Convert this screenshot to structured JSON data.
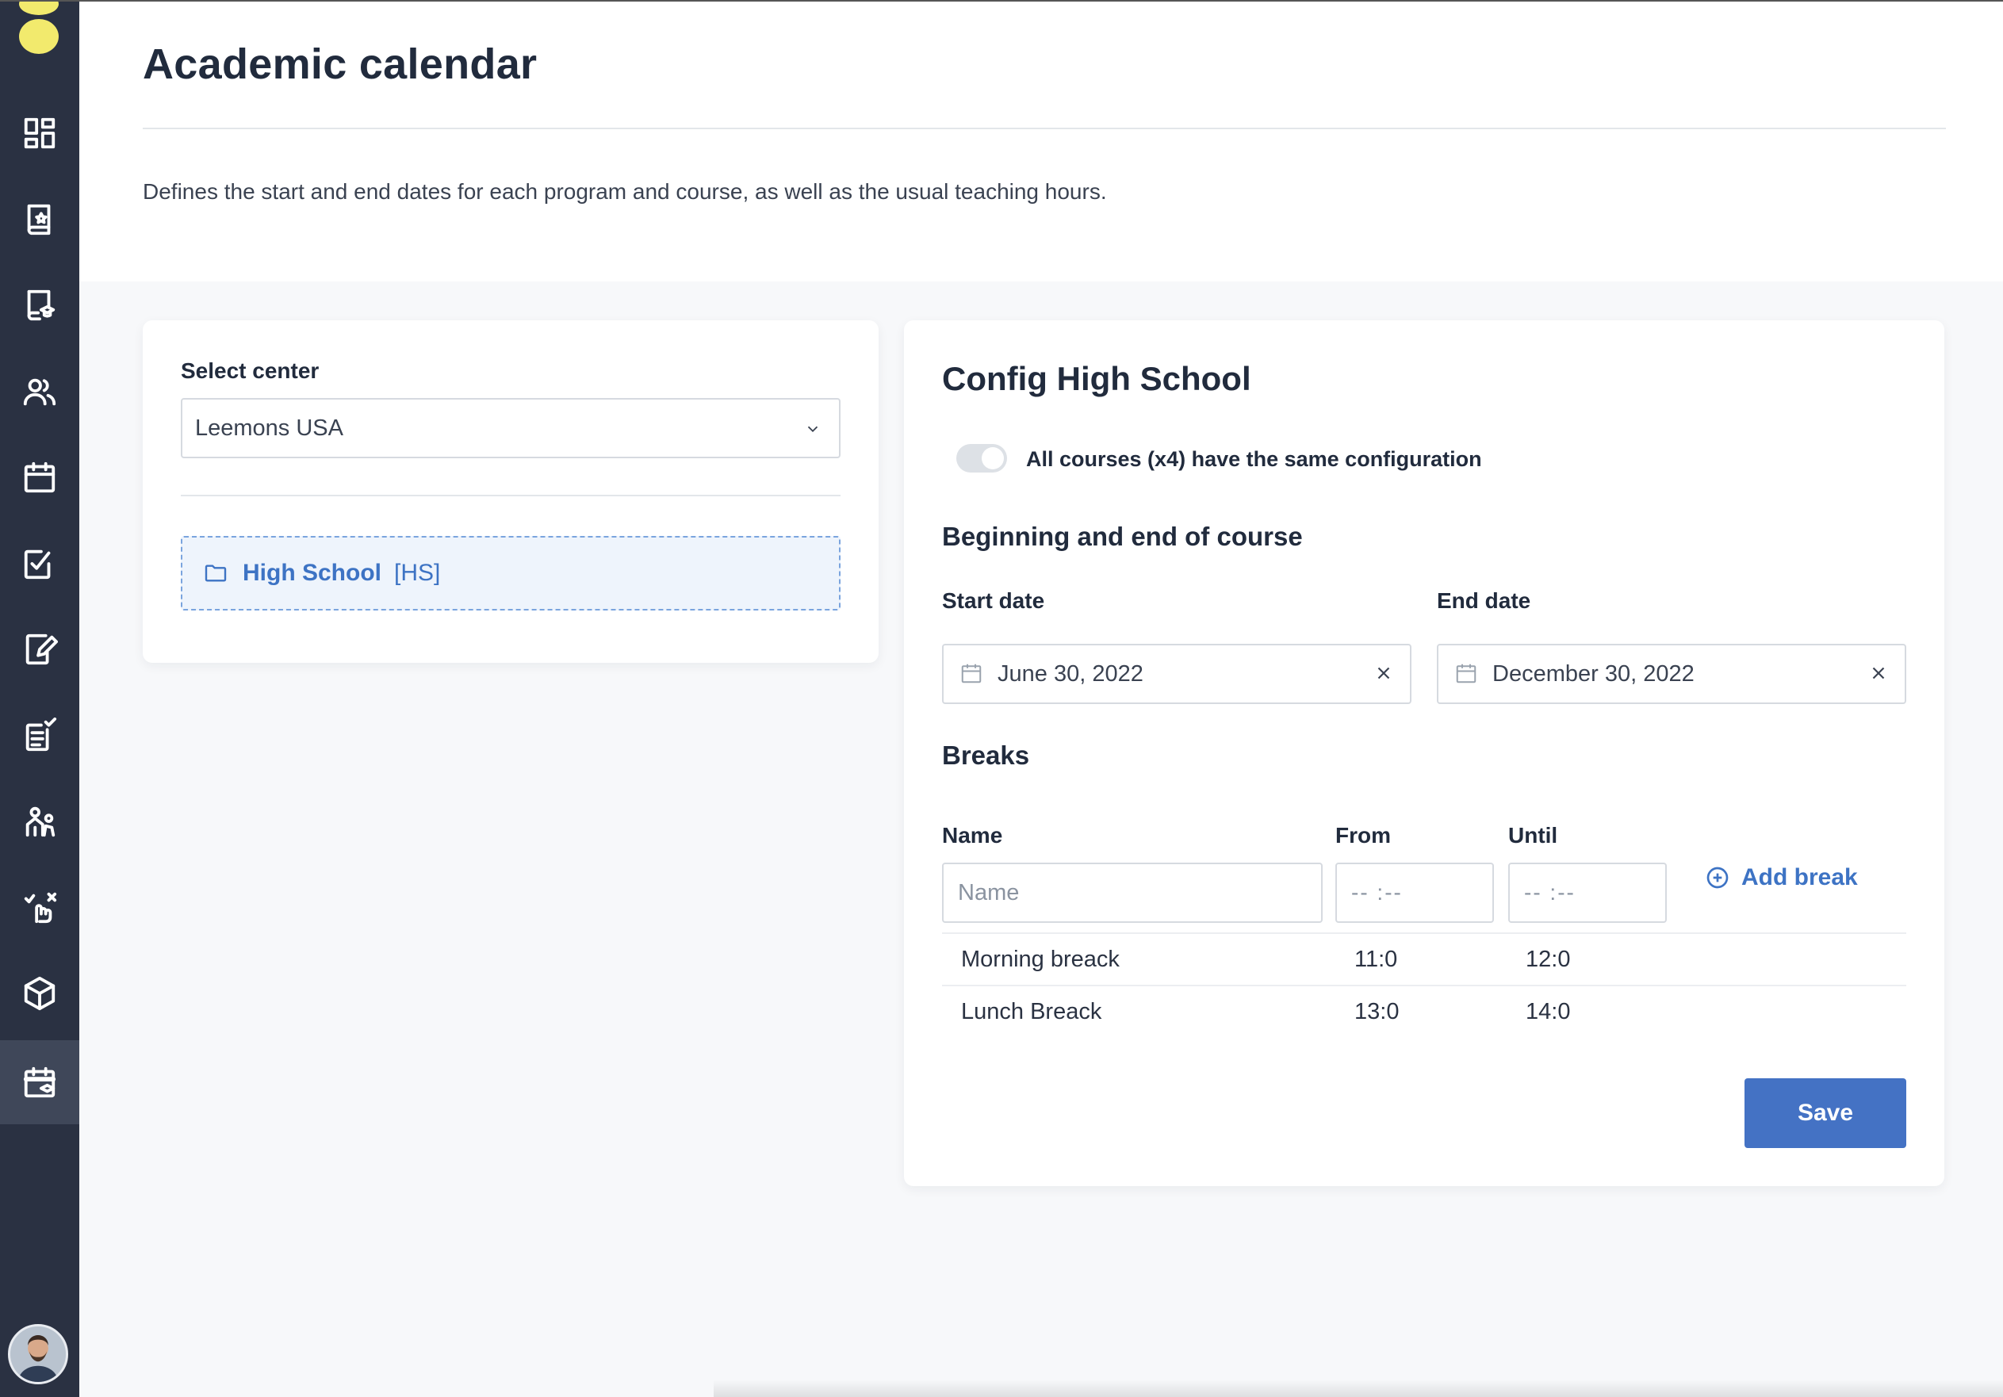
{
  "app": {
    "accent_color": "#4472c4",
    "sidebar_color": "#2a3142",
    "logo_color": "#f2ea6d"
  },
  "sidebar": {
    "items": [
      {
        "icon": "dashboard-icon"
      },
      {
        "icon": "book-star-icon"
      },
      {
        "icon": "book-graduation-icon"
      },
      {
        "icon": "users-icon"
      },
      {
        "icon": "calendar-icon"
      },
      {
        "icon": "task-check-icon"
      },
      {
        "icon": "edit-document-icon"
      },
      {
        "icon": "checklist-document-icon"
      },
      {
        "icon": "collaboration-icon"
      },
      {
        "icon": "gesture-icon"
      },
      {
        "icon": "cube-icon"
      },
      {
        "icon": "academic-calendar-icon",
        "active": true
      }
    ],
    "avatar": "user-avatar"
  },
  "header": {
    "title": "Academic calendar",
    "description": "Defines the start and end dates for each program and course, as well as the usual teaching hours."
  },
  "centerPanel": {
    "label": "Select center",
    "selected": "Leemons USA",
    "tree": {
      "name": "High School",
      "abbr": "[HS]"
    }
  },
  "config": {
    "title": "Config High School",
    "toggleLabel": "All courses (x4) have the same configuration",
    "courseSection": "Beginning and end of course",
    "startLabel": "Start date",
    "startValue": "June 30, 2022",
    "endLabel": "End date",
    "endValue": "December 30, 2022",
    "breaksTitle": "Breaks",
    "colName": "Name",
    "colFrom": "From",
    "colUntil": "Until",
    "namePlaceholder": "Name",
    "timePlaceholder": "-- :--",
    "addBreak": "Add break",
    "breaks": [
      {
        "name": "Morning breack",
        "from": "11:0",
        "until": "12:0"
      },
      {
        "name": "Lunch Breack",
        "from": "13:0",
        "until": "14:0"
      }
    ],
    "save": "Save"
  }
}
